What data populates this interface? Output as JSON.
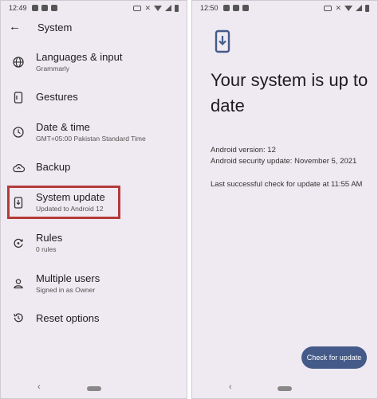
{
  "left_screen": {
    "status_time": "12:49",
    "title": "System",
    "items": [
      {
        "title": "Languages & input",
        "subtitle": "Grammarly"
      },
      {
        "title": "Gestures",
        "subtitle": ""
      },
      {
        "title": "Date & time",
        "subtitle": "GMT+05:00 Pakistan Standard Time"
      },
      {
        "title": "Backup",
        "subtitle": ""
      },
      {
        "title": "System update",
        "subtitle": "Updated to Android 12"
      },
      {
        "title": "Rules",
        "subtitle": "0 rules"
      },
      {
        "title": "Multiple users",
        "subtitle": "Signed in as Owner"
      },
      {
        "title": "Reset options",
        "subtitle": ""
      }
    ],
    "highlight_color": "#b53a3a"
  },
  "right_screen": {
    "status_time": "12:50",
    "heading": "Your system is up to date",
    "android_version": "Android version: 12",
    "security_update": "Android security update: November 5, 2021",
    "last_check": "Last successful check for update at 11:55 AM",
    "check_button": "Check for update",
    "accent": "#445b8a"
  },
  "icons": [
    "globe-icon",
    "gestures-icon",
    "clock-icon",
    "backup-icon",
    "system-update-icon",
    "rules-icon",
    "person-icon",
    "reset-icon",
    "back-arrow-icon"
  ]
}
